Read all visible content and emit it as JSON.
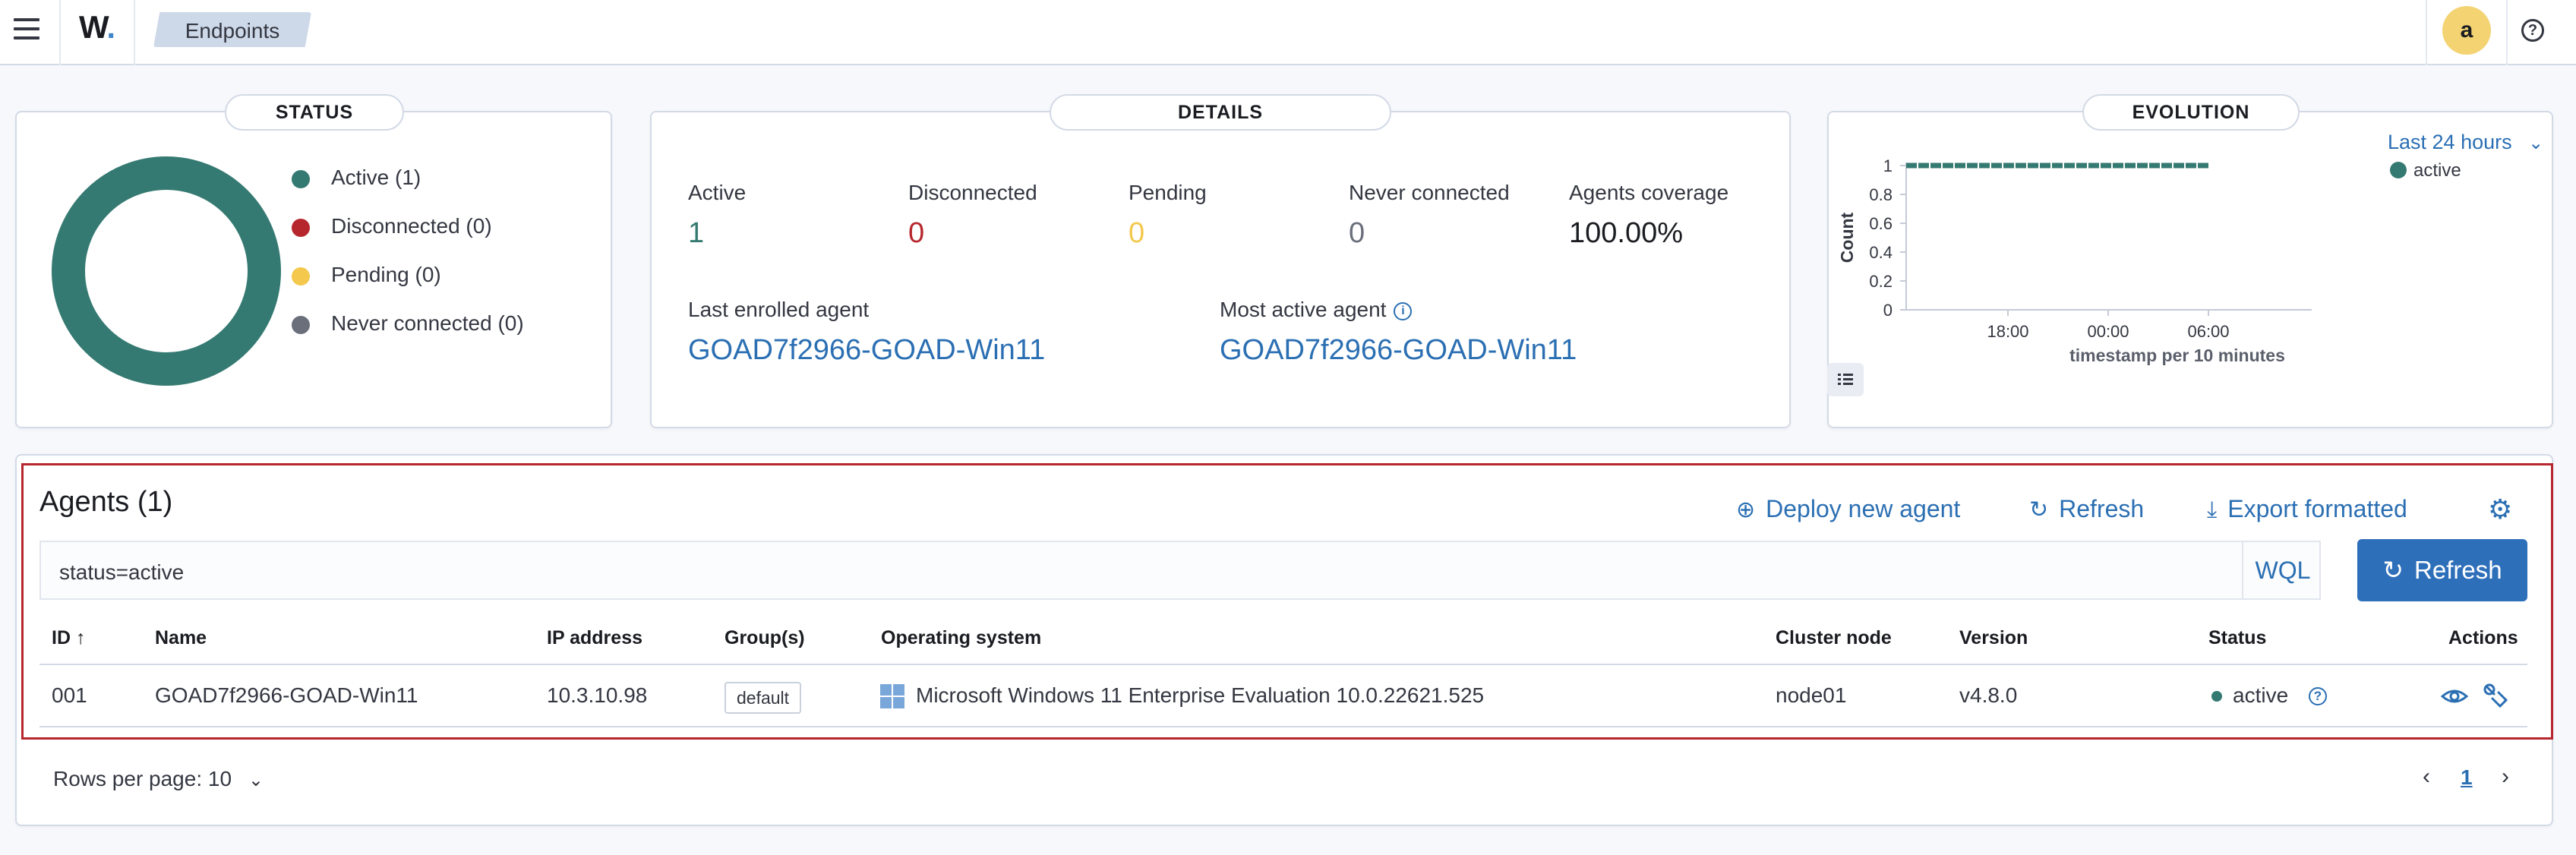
{
  "header": {
    "logo_text": "W",
    "logo_dot": ".",
    "breadcrumb": "Endpoints",
    "avatar_initial": "a",
    "help_symbol": "?"
  },
  "status": {
    "title": "STATUS",
    "legend": [
      {
        "label": "Active (1)",
        "color": "#357a72"
      },
      {
        "label": "Disconnected (0)",
        "color": "#b6262d"
      },
      {
        "label": "Pending (0)",
        "color": "#f3c84c"
      },
      {
        "label": "Never connected (0)",
        "color": "#6a6f7b"
      }
    ]
  },
  "details": {
    "title": "DETAILS",
    "stats": [
      {
        "label": "Active",
        "value": "1",
        "color": "#357a72"
      },
      {
        "label": "Disconnected",
        "value": "0",
        "color": "#b6262d"
      },
      {
        "label": "Pending",
        "value": "0",
        "color": "#f3c84c"
      },
      {
        "label": "Never connected",
        "value": "0",
        "color": "#6a6f7b"
      },
      {
        "label": "Agents coverage",
        "value": "100.00%",
        "color": "#1a1c21"
      }
    ],
    "last_enrolled_label": "Last enrolled agent",
    "last_enrolled_value": "GOAD7f2966-GOAD-Win11",
    "most_active_label": "Most active agent",
    "most_active_value": "GOAD7f2966-GOAD-Win11",
    "info_symbol": "i"
  },
  "evolution": {
    "title": "EVOLUTION",
    "time_range": "Last 24 hours",
    "legend_label": "active"
  },
  "chart_data": {
    "type": "line",
    "x": [
      "18:00",
      "00:00",
      "06:00"
    ],
    "series": [
      {
        "name": "active",
        "values": [
          1,
          1,
          1
        ]
      }
    ],
    "xlabel": "timestamp per 10 minutes",
    "ylabel": "Count",
    "yticks": [
      "1",
      "0.8",
      "0.6",
      "0.4",
      "0.2",
      "0"
    ],
    "ylim": [
      0,
      1
    ],
    "legend": "top-right",
    "color": "#357a72"
  },
  "agents": {
    "title": "Agents (1)",
    "deploy_label": "Deploy new agent",
    "refresh_label": "Refresh",
    "export_label": "Export formatted",
    "search_value": "status=active",
    "wql_label": "WQL",
    "refresh_button_label": "Refresh",
    "columns": [
      "ID ↑",
      "Name",
      "IP address",
      "Group(s)",
      "Operating system",
      "Cluster node",
      "Version",
      "Status",
      "Actions"
    ],
    "rows": [
      {
        "id": "001",
        "name": "GOAD7f2966-GOAD-Win11",
        "ip": "10.3.10.98",
        "group": "default",
        "os": "Microsoft Windows 11 Enterprise Evaluation 10.0.22621.525",
        "cluster_node": "node01",
        "version": "v4.8.0",
        "status": "active"
      }
    ],
    "rows_per_page": "Rows per page: 10",
    "current_page": "1"
  }
}
